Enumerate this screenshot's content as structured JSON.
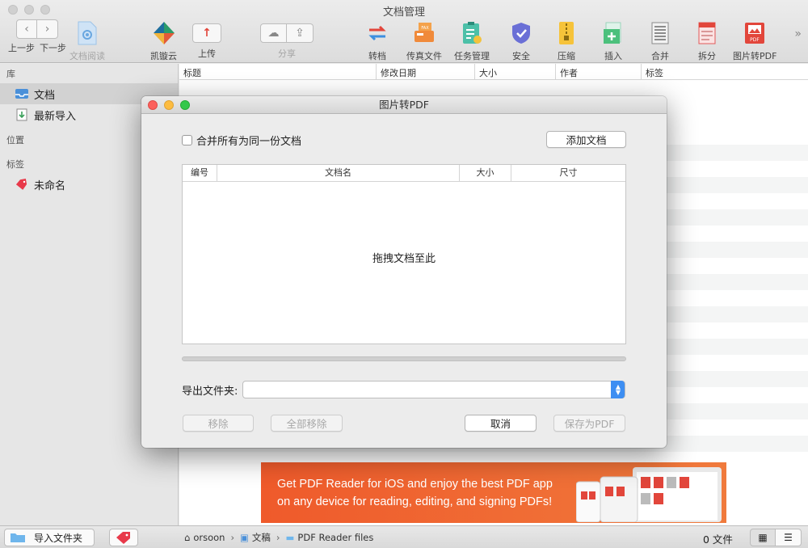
{
  "window": {
    "title": "文档管理"
  },
  "toolbar": {
    "back_label": "上一步",
    "forward_label": "下一步",
    "reader_label": "文档阅读",
    "cloud_label": "凯镟云",
    "upload_label": "上传",
    "share_label": "分享",
    "tools": [
      {
        "label": "转档",
        "icon": "convert-icon"
      },
      {
        "label": "传真文件",
        "icon": "fax-icon"
      },
      {
        "label": "任务管理",
        "icon": "task-icon"
      },
      {
        "label": "安全",
        "icon": "shield-icon"
      },
      {
        "label": "压缩",
        "icon": "zip-icon"
      },
      {
        "label": "插入",
        "icon": "insert-icon"
      },
      {
        "label": "合并",
        "icon": "merge-icon"
      },
      {
        "label": "拆分",
        "icon": "split-icon"
      },
      {
        "label": "图片转PDF",
        "icon": "image-to-pdf-icon"
      }
    ],
    "overflow_glyph": "»"
  },
  "sidebar": {
    "library_header": "库",
    "items": [
      {
        "label": "文档",
        "icon": "inbox-icon",
        "selected": true
      },
      {
        "label": "最新导入",
        "icon": "import-icon",
        "selected": false
      }
    ],
    "location_header": "位置",
    "tags_header": "标签",
    "tags": [
      {
        "label": "未命名",
        "icon": "tag-icon",
        "color": "#e8394a"
      }
    ]
  },
  "list": {
    "columns": [
      "标题",
      "修改日期",
      "大小",
      "作者",
      "标签"
    ]
  },
  "banner": {
    "line1": "Get PDF Reader for iOS and enjoy the best PDF app",
    "line2": "on any device for reading, editing, and signing PDFs!"
  },
  "bottom": {
    "import_folder_label": "导入文件夹",
    "breadcrumb": [
      "orsoon",
      "文稿",
      "PDF Reader files"
    ],
    "file_count": "0 文件"
  },
  "dialog": {
    "title": "图片转PDF",
    "merge_checkbox_label": "合并所有为同一份文档",
    "merge_checked": false,
    "add_button": "添加文档",
    "table_columns": [
      "编号",
      "文档名",
      "大小",
      "尺寸"
    ],
    "empty_hint": "拖拽文档至此",
    "progress": 0,
    "export_label": "导出文件夹:",
    "export_value": "",
    "remove_button": "移除",
    "remove_all_button": "全部移除",
    "cancel_button": "取消",
    "save_button": "保存为PDF"
  },
  "colors": {
    "accent": "#3d8ef2",
    "banner": "#ef5a2b",
    "tag": "#e8394a"
  }
}
